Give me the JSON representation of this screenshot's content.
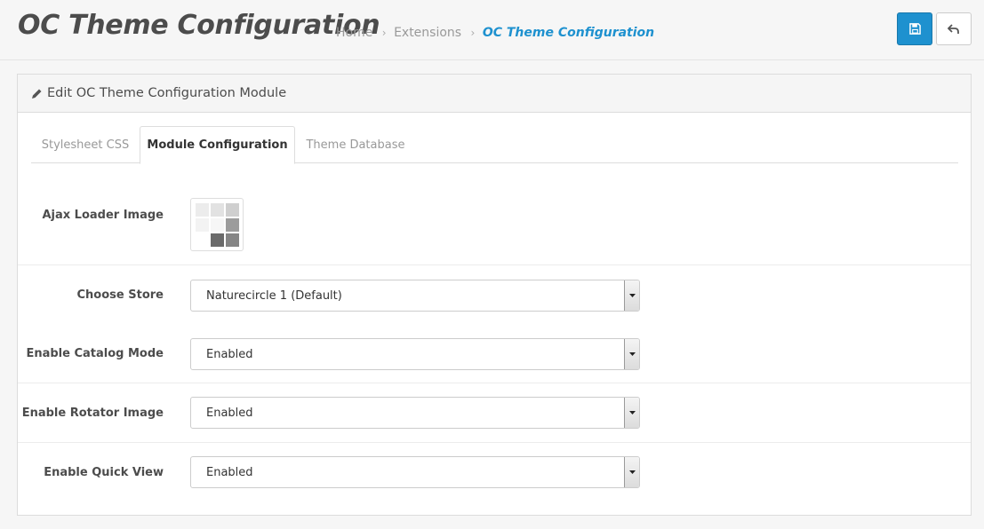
{
  "header": {
    "title": "OC Theme Configuration",
    "breadcrumb": [
      "Home",
      "Extensions",
      "OC Theme Configuration"
    ],
    "save_icon": "floppy-disk-icon",
    "back_icon": "reply-arrow-icon",
    "accent_color": "#1e91cf"
  },
  "panel": {
    "heading": "Edit OC Theme Configuration Module",
    "heading_icon": "pencil-icon",
    "tabs": [
      {
        "label": "Stylesheet CSS",
        "active": false
      },
      {
        "label": "Module Configuration",
        "active": true
      },
      {
        "label": "Theme Database",
        "active": false
      }
    ]
  },
  "form": {
    "ajax_loader": {
      "label": "Ajax Loader Image",
      "image_icon": "loader-grid-image"
    },
    "store": {
      "label": "Choose Store",
      "value": "Naturecircle 1 (Default)"
    },
    "catalog_mode": {
      "label": "Enable Catalog Mode",
      "value": "Enabled"
    },
    "rotator_image": {
      "label": "Enable Rotator Image",
      "value": "Enabled"
    },
    "quick_view": {
      "label": "Enable Quick View",
      "value": "Enabled"
    }
  }
}
